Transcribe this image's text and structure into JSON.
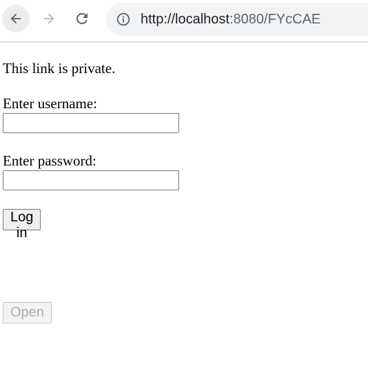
{
  "browser": {
    "url_host": "http://localhost",
    "url_rest": ":8080/FYcCAE",
    "icons": {
      "back": "arrow-left-icon",
      "forward": "arrow-right-icon",
      "reload": "reload-icon",
      "site_info": "info-icon"
    },
    "forward_enabled": false
  },
  "page": {
    "notice": "This link is private.",
    "username_label": "Enter username:",
    "username_value": "",
    "password_label": "Enter password:",
    "password_value": "",
    "login_label": "Log in",
    "open_label": "Open",
    "open_enabled": false
  },
  "colors": {
    "toolbar_border": "#dadce0",
    "omnibox_bg": "#f1f3f4",
    "icon_dark": "#5f6368",
    "icon_disabled": "#b4b6b9",
    "disabled_text": "#adadad"
  }
}
